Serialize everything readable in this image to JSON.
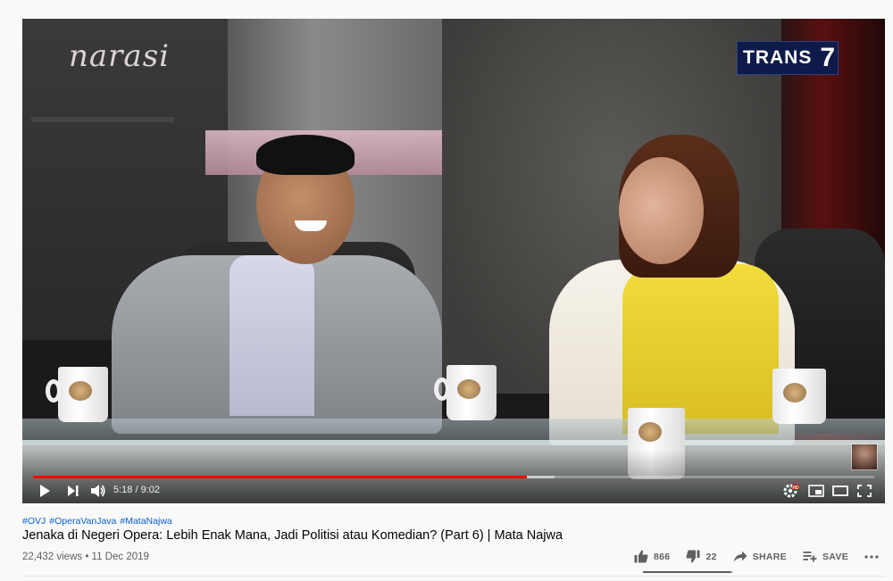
{
  "player": {
    "watermark": "narasi",
    "channel_logo": {
      "text": "TRANS",
      "number": "7"
    },
    "current_time": "5:18",
    "duration": "9:02",
    "time_display": "5:18 / 9:02",
    "progress_fraction": 0.587,
    "buffered_fraction": 0.62,
    "hd_badge": "HD",
    "mug_brand": "Mata Najwa",
    "controls": {
      "play": "play-icon",
      "next": "next-icon",
      "volume": "volume-icon",
      "settings": "settings-icon",
      "miniplayer": "miniplayer-icon",
      "theater": "theater-icon",
      "fullscreen": "fullscreen-icon"
    }
  },
  "video": {
    "hashtags": [
      "#OVJ",
      "#OperaVanJava",
      "#MataNajwa"
    ],
    "title": "Jenaka di Negeri Opera: Lebih Enak Mana, Jadi Politisi atau Komedian? (Part 6) | Mata Najwa",
    "views": "22,432 views",
    "date": "11 Dec 2019",
    "meta_line": "22,432 views • 11 Dec 2019"
  },
  "actions": {
    "likes": "866",
    "dislikes": "22",
    "like_fraction": 0.975,
    "share_label": "SHARE",
    "save_label": "SAVE",
    "more": "more-icon"
  },
  "colors": {
    "progress": "#ff0000",
    "hashtag": "#065fd4",
    "text_primary": "#030303",
    "text_secondary": "#606060",
    "channel_logo_bg": "#0e1a4a"
  }
}
